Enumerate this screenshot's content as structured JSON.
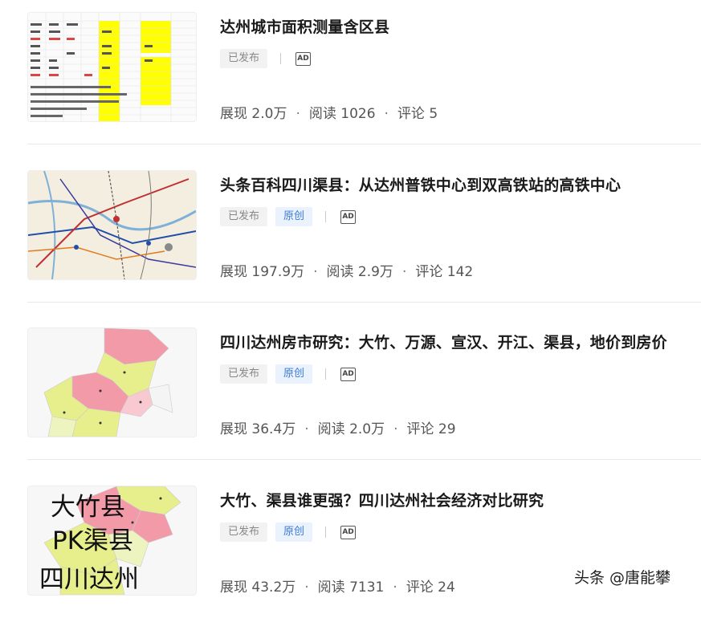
{
  "articles": [
    {
      "title": "达州城市面积测量含区县",
      "tags": {
        "published": "已发布",
        "original": ""
      },
      "ad_label": "AD",
      "stats": {
        "impressions": "展现 2.0万",
        "reads": "阅读 1026",
        "comments": "评论 5"
      }
    },
    {
      "title": "头条百科四川渠县：从达州普铁中心到双高铁站的高铁中心",
      "tags": {
        "published": "已发布",
        "original": "原创"
      },
      "ad_label": "AD",
      "stats": {
        "impressions": "展现 197.9万",
        "reads": "阅读 2.9万",
        "comments": "评论 142"
      }
    },
    {
      "title": "四川达州房市研究：大竹、万源、宣汉、开江、渠县，地价到房价",
      "tags": {
        "published": "已发布",
        "original": "原创"
      },
      "ad_label": "AD",
      "stats": {
        "impressions": "展现 36.4万",
        "reads": "阅读 2.0万",
        "comments": "评论 29"
      }
    },
    {
      "title": "大竹、渠县谁更强？四川达州社会经济对比研究",
      "tags": {
        "published": "已发布",
        "original": "原创"
      },
      "ad_label": "AD",
      "stats": {
        "impressions": "展现 43.2万",
        "reads": "阅读 7131",
        "comments": "评论 24"
      },
      "thumb_text": [
        "大竹县",
        "PK渠县",
        "四川达州"
      ]
    }
  ],
  "watermark": "头条 @唐能攀",
  "colors": {
    "original_tag": "#3e7bd8",
    "published_tag_bg": "#f2f2f2",
    "highlight_yellow": "#ffff00"
  }
}
